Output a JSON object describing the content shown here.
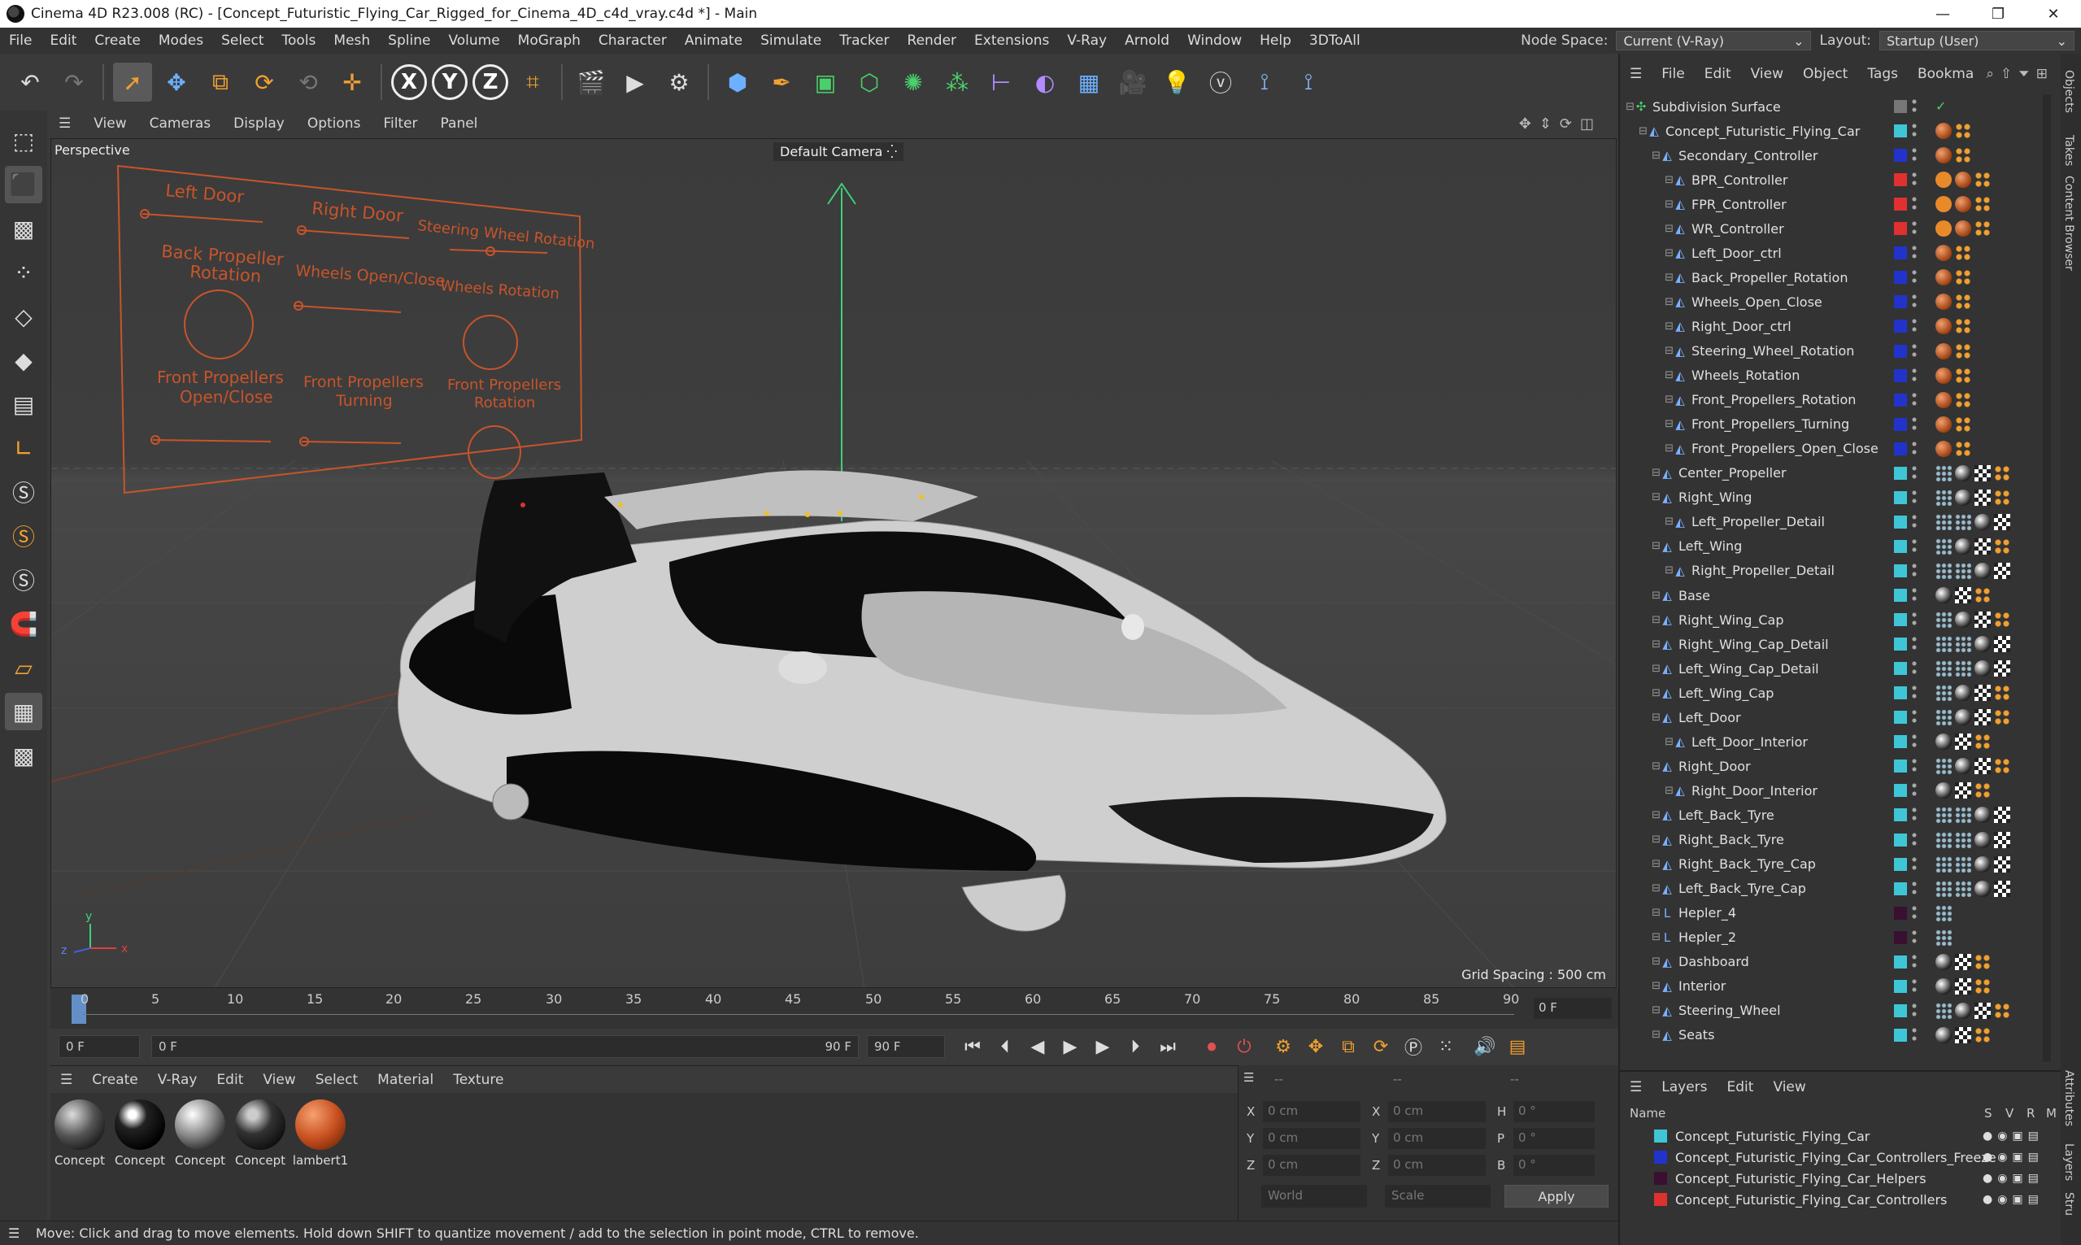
{
  "window": {
    "title": "Cinema 4D R23.008 (RC) - [Concept_Futuristic_Flying_Car_Rigged_for_Cinema_4D_c4d_vray.c4d *] - Main",
    "minimize": "—",
    "maximize": "❐",
    "close": "✕"
  },
  "menubar": {
    "items": [
      "File",
      "Edit",
      "Create",
      "Modes",
      "Select",
      "Tools",
      "Mesh",
      "Spline",
      "Volume",
      "MoGraph",
      "Character",
      "Animate",
      "Simulate",
      "Tracker",
      "Render",
      "Extensions",
      "V-Ray",
      "Arnold",
      "Window",
      "Help",
      "3DToAll"
    ],
    "node_space_label": "Node Space:",
    "node_space_value": "Current (V-Ray)",
    "layout_label": "Layout:",
    "layout_value": "Startup (User)"
  },
  "toolbar": {
    "x": "X",
    "y": "Y",
    "z": "Z"
  },
  "viewport": {
    "menu": [
      "View",
      "Cameras",
      "Display",
      "Options",
      "Filter",
      "Panel"
    ],
    "projection": "Perspective",
    "camera": "Default Camera",
    "grid_spacing": "Grid Spacing : 500 cm",
    "axis_x": "x",
    "axis_y": "y",
    "axis_z": "z",
    "controller_panel": {
      "left_door": "Left Door",
      "right_door": "Right Door",
      "steering": "Steering Wheel Rotation",
      "back_prop_1": "Back Propeller",
      "back_prop_2": "Rotation",
      "wheels_open": "Wheels Open/Close",
      "wheels_rot": "Wheels Rotation",
      "front_open_1": "Front Propellers",
      "front_open_2": "Open/Close",
      "front_turn_1": "Front Propellers",
      "front_turn_2": "Turning",
      "front_rot_1": "Front Propellers",
      "front_rot_2": "Rotation"
    }
  },
  "timeline": {
    "ticks": [
      "0",
      "5",
      "10",
      "15",
      "20",
      "25",
      "30",
      "35",
      "40",
      "45",
      "50",
      "55",
      "60",
      "65",
      "70",
      "75",
      "80",
      "85",
      "90"
    ],
    "current_frame": "0 F"
  },
  "transport": {
    "start": "0 F",
    "range_start": "0 F",
    "range_end": "90 F",
    "end": "90 F"
  },
  "materials": {
    "menu": [
      "Create",
      "V-Ray",
      "Edit",
      "View",
      "Select",
      "Material",
      "Texture"
    ],
    "items": [
      {
        "label": "Concept",
        "type": "gray"
      },
      {
        "label": "Concept",
        "type": "black"
      },
      {
        "label": "Concept",
        "type": "silver"
      },
      {
        "label": "Concept",
        "type": "dark"
      },
      {
        "label": "lambert1",
        "type": "orange"
      }
    ]
  },
  "coords": {
    "header_a": "--",
    "header_b": "--",
    "header_c": "--",
    "x_label": "X",
    "y_label": "Y",
    "z_label": "Z",
    "h_label": "H",
    "p_label": "P",
    "b_label": "B",
    "pos_x": "0 cm",
    "pos_y": "0 cm",
    "pos_z": "0 cm",
    "size_x": "0 cm",
    "size_y": "0 cm",
    "size_z": "0 cm",
    "rot_h": "0 °",
    "rot_p": "0 °",
    "rot_b": "0 °",
    "space": "World",
    "mode": "Scale",
    "apply": "Apply"
  },
  "objects": {
    "menu": [
      "File",
      "Edit",
      "View",
      "Object",
      "Tags",
      "Bookma"
    ],
    "rows": [
      {
        "name": "Subdivision Surface",
        "indent": 0,
        "color": "",
        "icon": "✣",
        "tags": "check"
      },
      {
        "name": "Concept_Futuristic_Flying_Car",
        "indent": 1,
        "color": "#3fc6d6",
        "icon": "◭",
        "tags": "ball"
      },
      {
        "name": "Secondary_Controller",
        "indent": 2,
        "color": "#2233cc",
        "icon": "◭",
        "tags": "ball"
      },
      {
        "name": "BPR_Controller",
        "indent": 3,
        "color": "#e03030",
        "icon": "◭",
        "tags": "nogo"
      },
      {
        "name": "FPR_Controller",
        "indent": 3,
        "color": "#e03030",
        "icon": "◭",
        "tags": "nogo"
      },
      {
        "name": "WR_Controller",
        "indent": 3,
        "color": "#e03030",
        "icon": "◭",
        "tags": "nogo"
      },
      {
        "name": "Left_Door_ctrl",
        "indent": 3,
        "color": "#2233cc",
        "icon": "◭",
        "tags": "ball"
      },
      {
        "name": "Back_Propeller_Rotation",
        "indent": 3,
        "color": "#2233cc",
        "icon": "◭",
        "tags": "ball"
      },
      {
        "name": "Wheels_Open_Close",
        "indent": 3,
        "color": "#2233cc",
        "icon": "◭",
        "tags": "ball"
      },
      {
        "name": "Right_Door_ctrl",
        "indent": 3,
        "color": "#2233cc",
        "icon": "◭",
        "tags": "ball"
      },
      {
        "name": "Steering_Wheel_Rotation",
        "indent": 3,
        "color": "#2233cc",
        "icon": "◭",
        "tags": "ball"
      },
      {
        "name": "Wheels_Rotation",
        "indent": 3,
        "color": "#2233cc",
        "icon": "◭",
        "tags": "ball"
      },
      {
        "name": "Front_Propellers_Rotation",
        "indent": 3,
        "color": "#2233cc",
        "icon": "◭",
        "tags": "ball"
      },
      {
        "name": "Front_Propellers_Turning",
        "indent": 3,
        "color": "#2233cc",
        "icon": "◭",
        "tags": "ball"
      },
      {
        "name": "Front_Propellers_Open_Close",
        "indent": 3,
        "color": "#2233cc",
        "icon": "◭",
        "tags": "ball"
      },
      {
        "name": "Center_Propeller",
        "indent": 2,
        "color": "#3fc6d6",
        "icon": "◭",
        "tags": "mesh"
      },
      {
        "name": "Right_Wing",
        "indent": 2,
        "color": "#3fc6d6",
        "icon": "◭",
        "tags": "mesh"
      },
      {
        "name": "Left_Propeller_Detail",
        "indent": 3,
        "color": "#3fc6d6",
        "icon": "◭",
        "tags": "mesh2"
      },
      {
        "name": "Left_Wing",
        "indent": 2,
        "color": "#3fc6d6",
        "icon": "◭",
        "tags": "mesh"
      },
      {
        "name": "Right_Propeller_Detail",
        "indent": 3,
        "color": "#3fc6d6",
        "icon": "◭",
        "tags": "mesh2"
      },
      {
        "name": "Base",
        "indent": 2,
        "color": "#3fc6d6",
        "icon": "◭",
        "tags": "simple"
      },
      {
        "name": "Right_Wing_Cap",
        "indent": 2,
        "color": "#3fc6d6",
        "icon": "◭",
        "tags": "mesh"
      },
      {
        "name": "Right_Wing_Cap_Detail",
        "indent": 2,
        "color": "#3fc6d6",
        "icon": "◭",
        "tags": "mesh2"
      },
      {
        "name": "Left_Wing_Cap_Detail",
        "indent": 2,
        "color": "#3fc6d6",
        "icon": "◭",
        "tags": "mesh2"
      },
      {
        "name": "Left_Wing_Cap",
        "indent": 2,
        "color": "#3fc6d6",
        "icon": "◭",
        "tags": "mesh"
      },
      {
        "name": "Left_Door",
        "indent": 2,
        "color": "#3fc6d6",
        "icon": "◭",
        "tags": "mesh"
      },
      {
        "name": "Left_Door_Interior",
        "indent": 3,
        "color": "#3fc6d6",
        "icon": "◭",
        "tags": "simple"
      },
      {
        "name": "Right_Door",
        "indent": 2,
        "color": "#3fc6d6",
        "icon": "◭",
        "tags": "mesh"
      },
      {
        "name": "Right_Door_Interior",
        "indent": 3,
        "color": "#3fc6d6",
        "icon": "◭",
        "tags": "simple"
      },
      {
        "name": "Left_Back_Tyre",
        "indent": 2,
        "color": "#3fc6d6",
        "icon": "◭",
        "tags": "mesh2"
      },
      {
        "name": "Right_Back_Tyre",
        "indent": 2,
        "color": "#3fc6d6",
        "icon": "◭",
        "tags": "mesh2"
      },
      {
        "name": "Right_Back_Tyre_Cap",
        "indent": 2,
        "color": "#3fc6d6",
        "icon": "◭",
        "tags": "mesh2"
      },
      {
        "name": "Left_Back_Tyre_Cap",
        "indent": 2,
        "color": "#3fc6d6",
        "icon": "◭",
        "tags": "mesh2"
      },
      {
        "name": "Hepler_4",
        "indent": 2,
        "color": "#3a1030",
        "icon": "L",
        "tags": "dots"
      },
      {
        "name": "Hepler_2",
        "indent": 2,
        "color": "#3a1030",
        "icon": "L",
        "tags": "dots"
      },
      {
        "name": "Dashboard",
        "indent": 2,
        "color": "#3fc6d6",
        "icon": "◭",
        "tags": "simple"
      },
      {
        "name": "Interior",
        "indent": 2,
        "color": "#3fc6d6",
        "icon": "◭",
        "tags": "simple"
      },
      {
        "name": "Steering_Wheel",
        "indent": 2,
        "color": "#3fc6d6",
        "icon": "◭",
        "tags": "mesh"
      },
      {
        "name": "Seats",
        "indent": 2,
        "color": "#3fc6d6",
        "icon": "◭",
        "tags": "simple"
      }
    ]
  },
  "layers": {
    "menu": [
      "Layers",
      "Edit",
      "View"
    ],
    "col_name": "Name",
    "col_s": "S",
    "col_v": "V",
    "col_r": "R",
    "col_m": "M",
    "items": [
      {
        "name": "Concept_Futuristic_Flying_Car",
        "color": "#3fc6d6"
      },
      {
        "name": "Concept_Futuristic_Flying_Car_Controllers_Freeze",
        "color": "#2233cc"
      },
      {
        "name": "Concept_Futuristic_Flying_Car_Helpers",
        "color": "#3a1030"
      },
      {
        "name": "Concept_Futuristic_Flying_Car_Controllers",
        "color": "#e03030"
      }
    ]
  },
  "sidetabs": [
    "Objects",
    "Takes",
    "Content Browser",
    "Attributes",
    "Layers",
    "Stru"
  ],
  "status": "Move: Click and drag to move elements. Hold down SHIFT to quantize movement / add to the selection in point mode, CTRL to remove."
}
